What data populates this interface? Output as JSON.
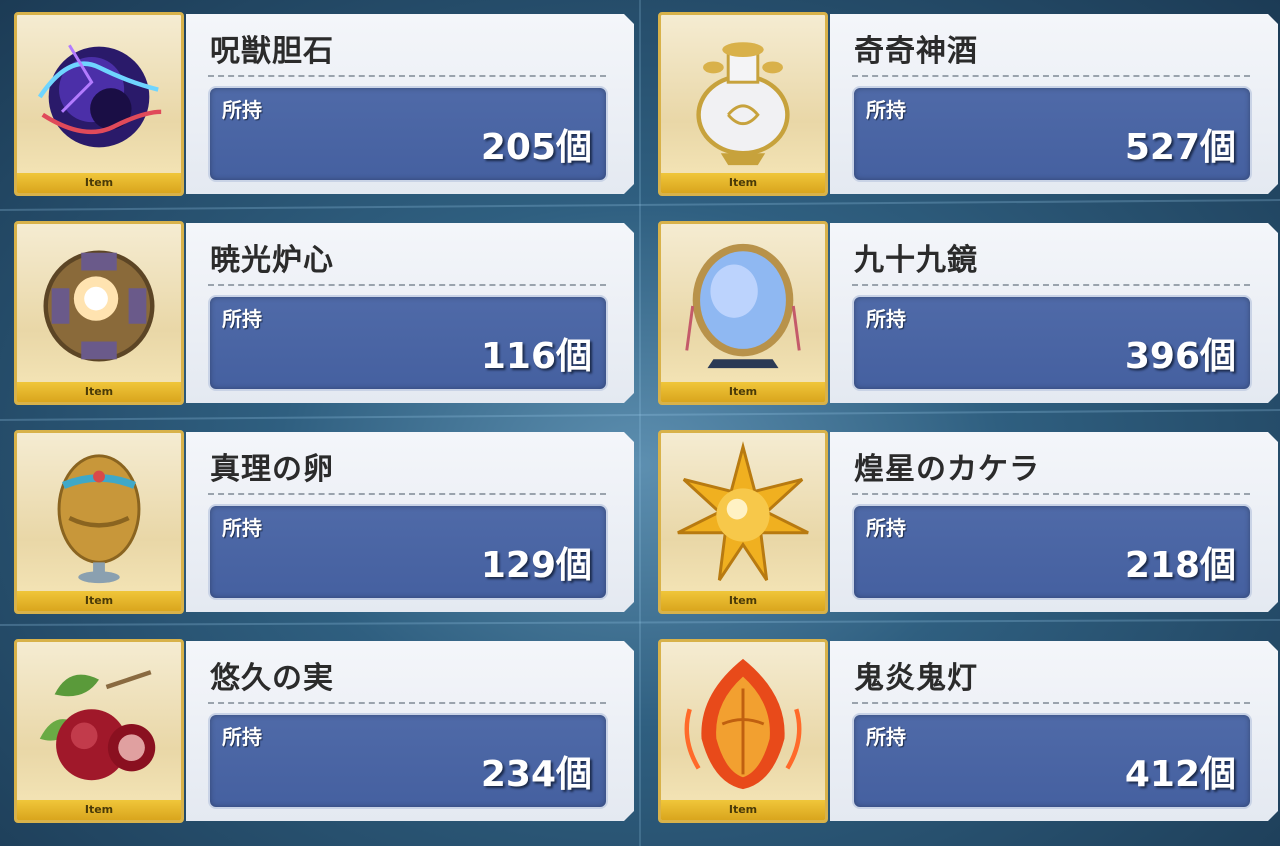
{
  "items": [
    {
      "name": "呪獣胆石",
      "own_label": "所持",
      "count": "205個",
      "tag": "Item",
      "icon": "cursed-beast-gallstone-icon"
    },
    {
      "name": "奇奇神酒",
      "own_label": "所持",
      "count": "527個",
      "tag": "Item",
      "icon": "divine-wine-vase-icon"
    },
    {
      "name": "暁光炉心",
      "own_label": "所持",
      "count": "116個",
      "tag": "Item",
      "icon": "dawnlight-reactor-core-icon"
    },
    {
      "name": "九十九鏡",
      "own_label": "所持",
      "count": "396個",
      "tag": "Item",
      "icon": "mirror-icon"
    },
    {
      "name": "真理の卵",
      "own_label": "所持",
      "count": "129個",
      "tag": "Item",
      "icon": "egg-of-truth-icon"
    },
    {
      "name": "煌星のカケラ",
      "own_label": "所持",
      "count": "218個",
      "tag": "Item",
      "icon": "star-shard-icon"
    },
    {
      "name": "悠久の実",
      "own_label": "所持",
      "count": "234個",
      "tag": "Item",
      "icon": "fig-fruit-icon"
    },
    {
      "name": "鬼炎鬼灯",
      "own_label": "所持",
      "count": "412個",
      "tag": "Item",
      "icon": "lantern-flame-icon"
    }
  ],
  "colors": {
    "tag": "#e0b02a",
    "count_box": "#4a64a4",
    "panel": "#eef1f6"
  }
}
